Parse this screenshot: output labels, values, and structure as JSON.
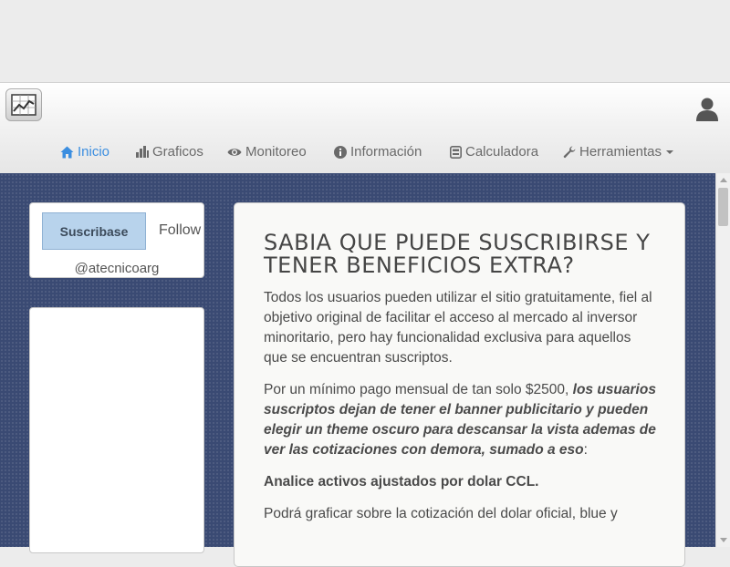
{
  "user": {
    "icon": "user-icon"
  },
  "nav": {
    "items": [
      {
        "label": "Inicio",
        "icon": "home-icon",
        "active": true
      },
      {
        "label": "Graficos",
        "icon": "bar-chart-icon"
      },
      {
        "label": "Monitoreo",
        "icon": "eye-icon"
      },
      {
        "label": "Información",
        "icon": "info-icon"
      },
      {
        "label": "Calculadora",
        "icon": "calculator-icon"
      },
      {
        "label": "Herramientas",
        "icon": "wrench-icon",
        "has_dropdown": true
      }
    ]
  },
  "sidebar": {
    "subscribe_label": "Suscribase",
    "follow_label": "Follow",
    "handle": "@atecnicoarg"
  },
  "content": {
    "heading": "Sabia que puede suscribirse y tener beneficios extra?",
    "p1": "Todos los usuarios pueden utilizar el sitio gratuitamente, fiel al objetivo original de facilitar el acceso al mercado al inversor minoritario, pero hay funcionalidad exclusiva para aquellos que se encuentran suscriptos.",
    "p2_prefix": "Por un mínimo pago mensual de tan solo $2500, ",
    "p2_emphasis": "los usuarios suscriptos dejan de tener el banner publicitario y pueden elegir un theme oscuro para descansar la vista ademas de ver las cotizaciones con demora, sumado a eso",
    "p2_suffix": ":",
    "p3": "Analice activos ajustados por dolar CCL.",
    "p4": "Podrá graficar sobre la cotización del dolar oficial, blue y"
  },
  "colors": {
    "background_pattern": "#3a4a73",
    "nav_active": "#3b8ee0",
    "subscribe_button": "#b8d3ec"
  }
}
